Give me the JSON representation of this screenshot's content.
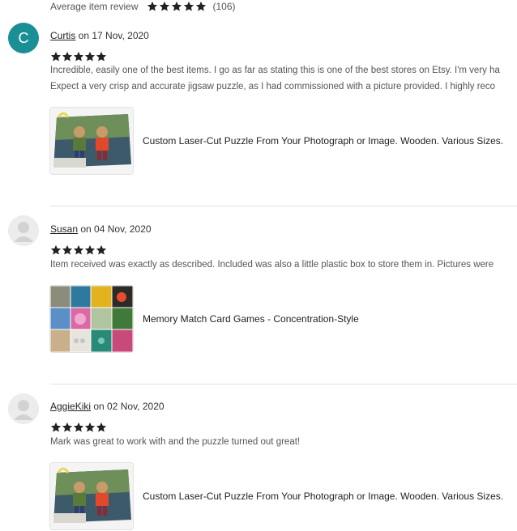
{
  "summary": {
    "label": "Average item review",
    "rating": 5,
    "count": "(106)"
  },
  "star_color": "#222222",
  "avatar_color": "#1a8f96",
  "reviews": [
    {
      "avatar_letter": "C",
      "author": "Curtis",
      "on": " on ",
      "date": "17 Nov, 2020",
      "rating": 5,
      "lines": [
        "Incredible, easily one of the best items. I go as far as stating this is one of the best stores on Etsy. I'm very ha",
        "Expect a very crisp and accurate jigsaw puzzle, as I had commissioned with a picture provided. I highly reco"
      ],
      "item_title": "Custom Laser-Cut Puzzle From Your Photograph or Image. Wooden. Various Sizes.",
      "item_icon": "puzzle-photo"
    },
    {
      "avatar_letter": "",
      "author": "Susan",
      "on": " on ",
      "date": "04 Nov, 2020",
      "rating": 5,
      "lines": [
        "Item received was exactly as described. Included was also a little plastic box to store them in. Pictures were"
      ],
      "item_title": "Memory Match Card Games - Concentration-Style",
      "item_icon": "card-grid"
    },
    {
      "avatar_letter": "",
      "author": "AggieKiki",
      "on": " on ",
      "date": "02 Nov, 2020",
      "rating": 5,
      "lines": [
        "Mark was great to work with and the puzzle turned out great!"
      ],
      "item_title": "Custom Laser-Cut Puzzle From Your Photograph or Image. Wooden. Various Sizes.",
      "item_icon": "puzzle-photo"
    }
  ]
}
